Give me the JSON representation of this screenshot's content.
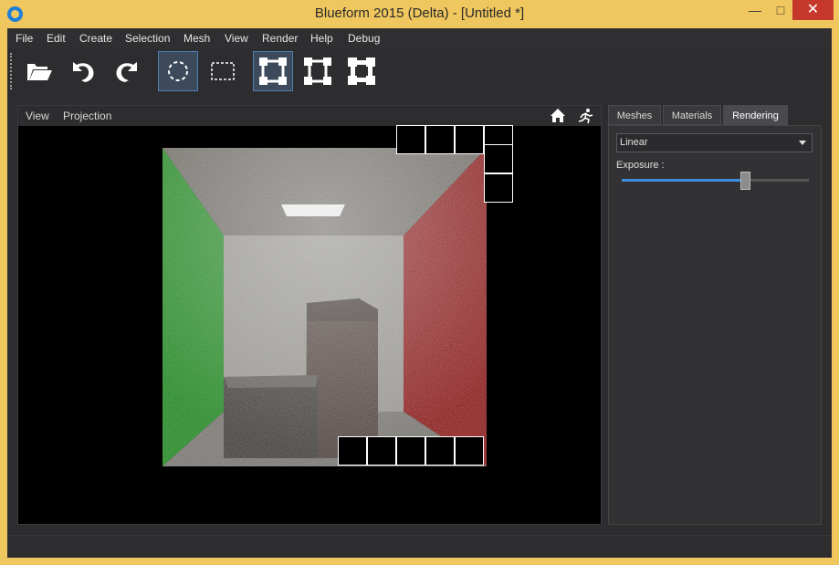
{
  "window": {
    "title": "Blueform 2015 (Delta) -  [Untitled *]",
    "minimize": "—",
    "maximize": "□",
    "close": "✕"
  },
  "menu": {
    "file": "File",
    "edit": "Edit",
    "create": "Create",
    "selection": "Selection",
    "mesh": "Mesh",
    "view": "View",
    "render": "Render",
    "help": "Help",
    "debug": "Debug"
  },
  "toolbar": {
    "tools": [
      "open-icon",
      "undo-icon",
      "redo-icon",
      "circle-select-icon",
      "rect-select-icon",
      "transform-icon",
      "rotate-transform-icon",
      "scale-transform-icon"
    ]
  },
  "viewport": {
    "view_menu": "View",
    "projection_menu": "Projection",
    "home": "home-icon",
    "walk": "walk-icon"
  },
  "panel": {
    "tabs": [
      "Meshes",
      "Materials",
      "Rendering"
    ],
    "active_tab": "Rendering",
    "tonemap": {
      "value": "Linear"
    },
    "exposure": {
      "label": "Exposure :",
      "level": 0.66
    }
  },
  "colors": {
    "accent": "#3e8ee0",
    "title_bar": "#f0c75e",
    "close": "#c7382c",
    "background": "#2d2d30"
  }
}
